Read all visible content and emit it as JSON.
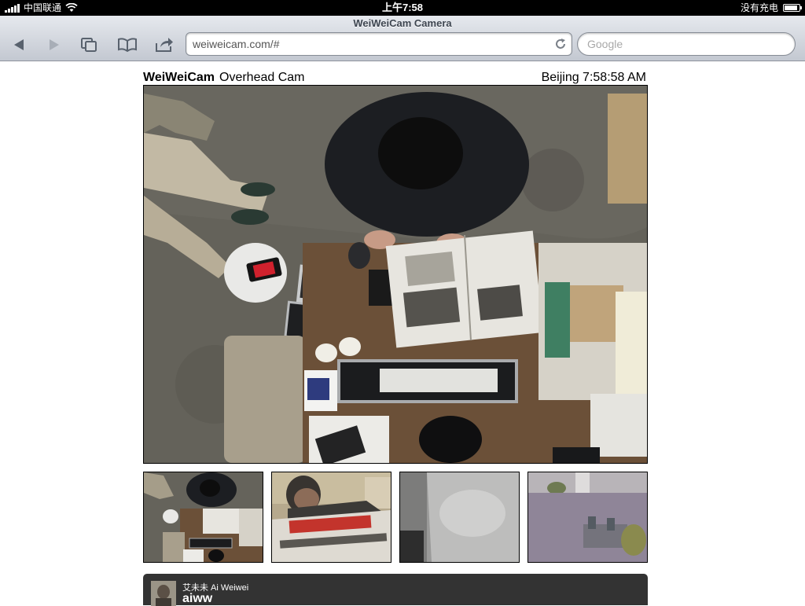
{
  "status_bar": {
    "carrier": "中国联通",
    "time": "上午7:58",
    "charging_text": "没有充电",
    "battery_level": 0.9
  },
  "browser": {
    "page_title": "WeiWeiCam Camera",
    "url": "weiweicam.com/#",
    "search_placeholder": "Google",
    "buttons": [
      "back-icon",
      "forward-icon",
      "pages-icon",
      "bookmarks-icon",
      "share-icon"
    ]
  },
  "camera_page": {
    "brand": "WeiWeiCam",
    "camera_name": "Overhead Cam",
    "clock": "Beijing 7:58:58 AM",
    "thumbnails": [
      "overhead-cam",
      "portrait-cam",
      "bed-cam",
      "courtyard-cam"
    ]
  },
  "profile": {
    "name": "艾未未 Ai Weiwei",
    "handle": "aiww"
  },
  "colors": {
    "profile_bar": "#333333",
    "toolbar_top": "#e6e9ee",
    "toolbar_bottom": "#c3c8d1"
  }
}
